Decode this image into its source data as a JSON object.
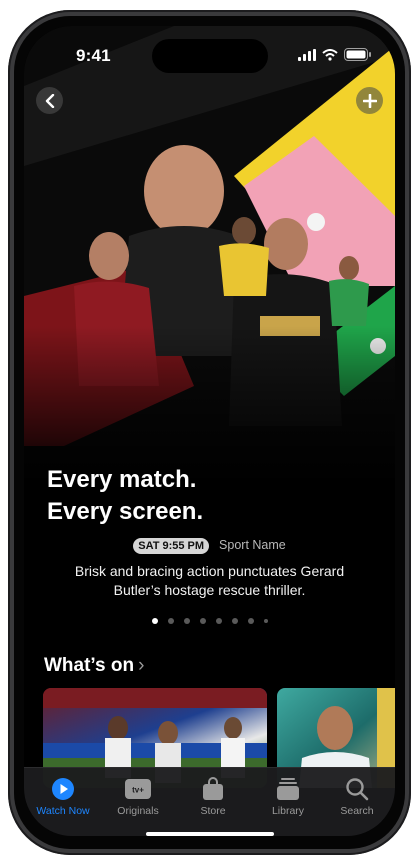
{
  "status_bar": {
    "time": "9:41"
  },
  "hero": {
    "headline_line1": "Every match.",
    "headline_line2": "Every screen.",
    "time_badge": "SAT 9:55 PM",
    "sport_name": "Sport Name",
    "description": "Brisk and bracing action punctuates Gerard Butler’s hostage rescue thriller.",
    "page_count": 8,
    "active_page": 1
  },
  "section": {
    "title": "What’s on"
  },
  "tabs": [
    {
      "label": "Watch Now",
      "icon": "play-circle-icon",
      "active": true
    },
    {
      "label": "Originals",
      "icon": "appletv-icon",
      "active": false
    },
    {
      "label": "Store",
      "icon": "bag-icon",
      "active": false
    },
    {
      "label": "Library",
      "icon": "stack-icon",
      "active": false
    },
    {
      "label": "Search",
      "icon": "search-icon",
      "active": false
    }
  ],
  "colors": {
    "accent": "#1e86ff",
    "hero_yellow": "#f2d22b",
    "hero_pink": "#f2a2b6",
    "hero_green": "#1fa54a",
    "hero_red": "#9a1b1f"
  }
}
